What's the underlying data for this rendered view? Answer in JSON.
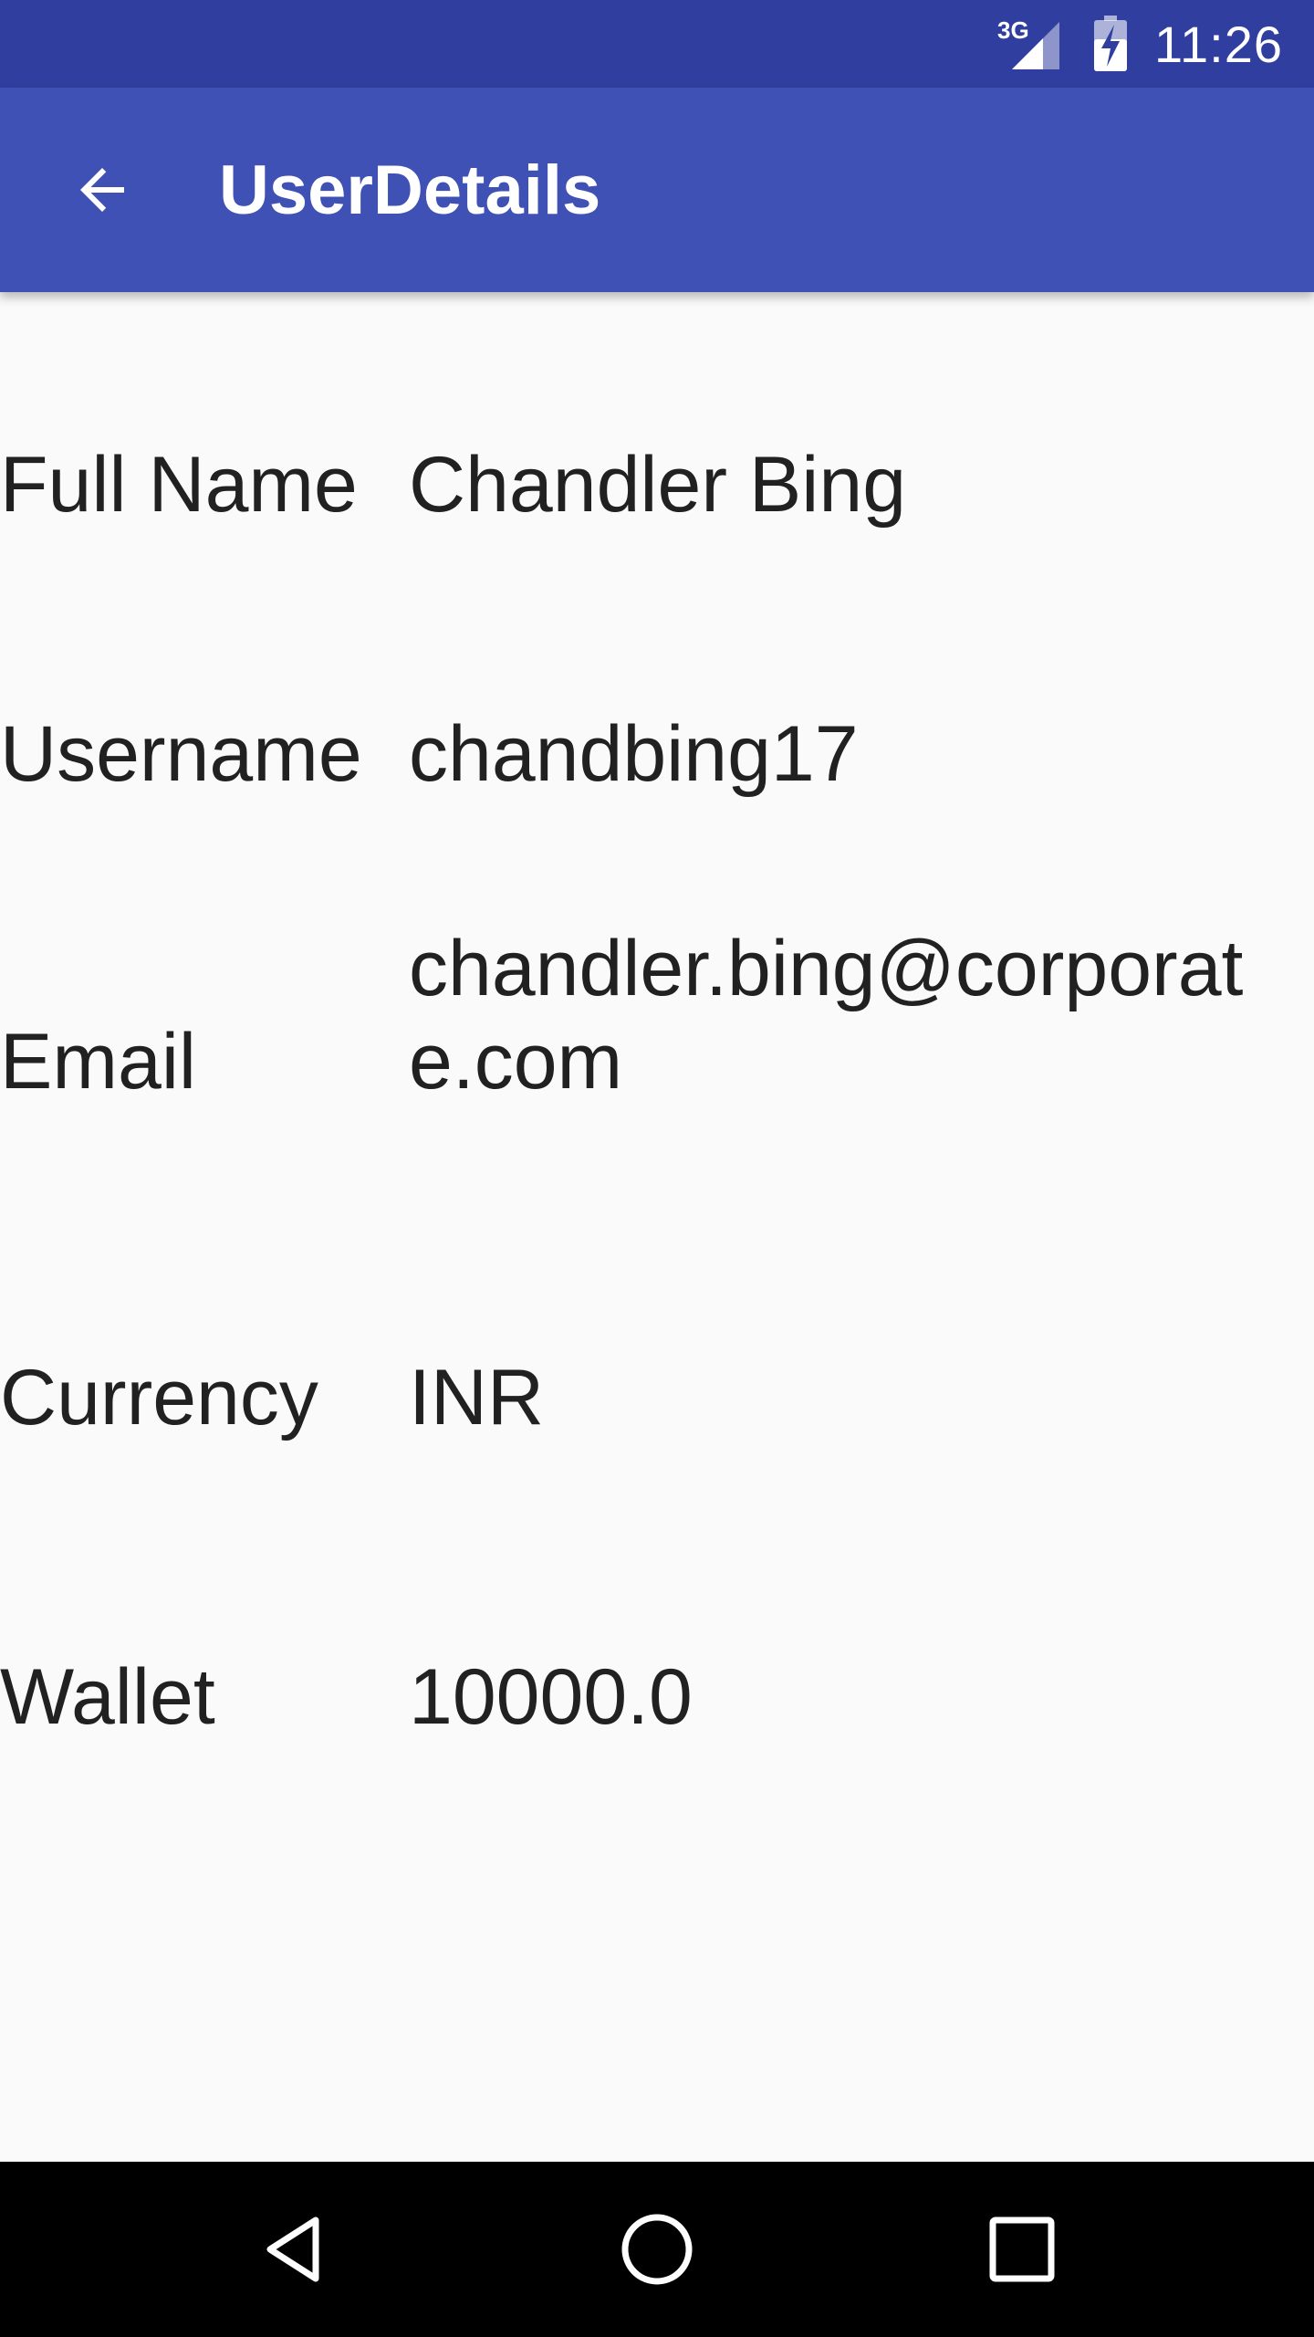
{
  "status_bar": {
    "network_type": "3G",
    "time": "11:26",
    "icons": [
      "signal-icon",
      "battery-charging-icon"
    ]
  },
  "app_bar": {
    "title": "UserDetails",
    "back_icon": "arrow-back-icon"
  },
  "details": [
    {
      "label": "Full Name",
      "value": "Chandler Bing"
    },
    {
      "label": "Username",
      "value": "chandbing17"
    },
    {
      "label": "Email",
      "value": "chandler.bing@corporate.com"
    },
    {
      "label": "Currency",
      "value": "INR"
    },
    {
      "label": "Wallet",
      "value": "10000.0"
    }
  ],
  "nav_bar": {
    "icons": [
      "back-triangle-icon",
      "home-circle-icon",
      "recents-square-icon"
    ]
  },
  "colors": {
    "status_bar": "#303f9f",
    "app_bar": "#3f51b5",
    "background": "#fafafa",
    "text": "#212121",
    "nav_bar": "#000000"
  }
}
